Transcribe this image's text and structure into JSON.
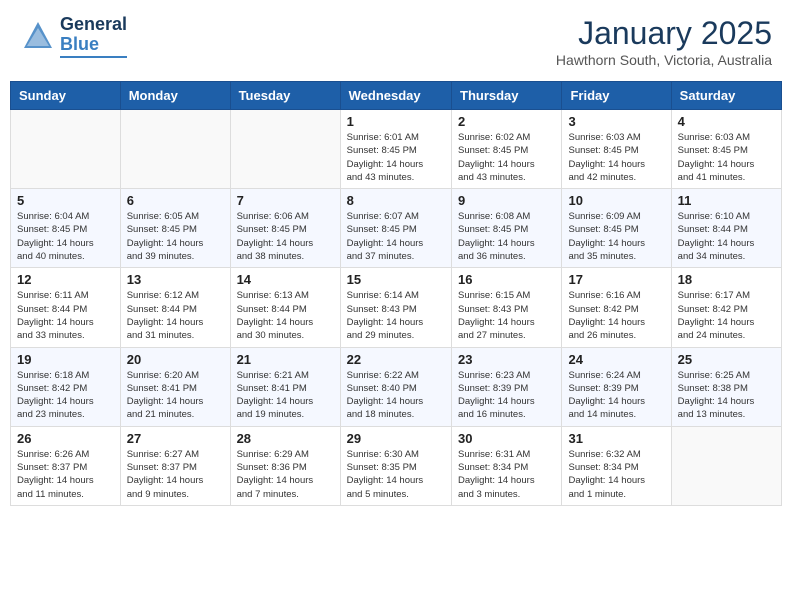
{
  "header": {
    "logo_general": "General",
    "logo_blue": "Blue",
    "month_title": "January 2025",
    "location": "Hawthorn South, Victoria, Australia"
  },
  "calendar": {
    "days_of_week": [
      "Sunday",
      "Monday",
      "Tuesday",
      "Wednesday",
      "Thursday",
      "Friday",
      "Saturday"
    ],
    "weeks": [
      [
        {
          "day": "",
          "info": ""
        },
        {
          "day": "",
          "info": ""
        },
        {
          "day": "",
          "info": ""
        },
        {
          "day": "1",
          "info": "Sunrise: 6:01 AM\nSunset: 8:45 PM\nDaylight: 14 hours\nand 43 minutes."
        },
        {
          "day": "2",
          "info": "Sunrise: 6:02 AM\nSunset: 8:45 PM\nDaylight: 14 hours\nand 43 minutes."
        },
        {
          "day": "3",
          "info": "Sunrise: 6:03 AM\nSunset: 8:45 PM\nDaylight: 14 hours\nand 42 minutes."
        },
        {
          "day": "4",
          "info": "Sunrise: 6:03 AM\nSunset: 8:45 PM\nDaylight: 14 hours\nand 41 minutes."
        }
      ],
      [
        {
          "day": "5",
          "info": "Sunrise: 6:04 AM\nSunset: 8:45 PM\nDaylight: 14 hours\nand 40 minutes."
        },
        {
          "day": "6",
          "info": "Sunrise: 6:05 AM\nSunset: 8:45 PM\nDaylight: 14 hours\nand 39 minutes."
        },
        {
          "day": "7",
          "info": "Sunrise: 6:06 AM\nSunset: 8:45 PM\nDaylight: 14 hours\nand 38 minutes."
        },
        {
          "day": "8",
          "info": "Sunrise: 6:07 AM\nSunset: 8:45 PM\nDaylight: 14 hours\nand 37 minutes."
        },
        {
          "day": "9",
          "info": "Sunrise: 6:08 AM\nSunset: 8:45 PM\nDaylight: 14 hours\nand 36 minutes."
        },
        {
          "day": "10",
          "info": "Sunrise: 6:09 AM\nSunset: 8:45 PM\nDaylight: 14 hours\nand 35 minutes."
        },
        {
          "day": "11",
          "info": "Sunrise: 6:10 AM\nSunset: 8:44 PM\nDaylight: 14 hours\nand 34 minutes."
        }
      ],
      [
        {
          "day": "12",
          "info": "Sunrise: 6:11 AM\nSunset: 8:44 PM\nDaylight: 14 hours\nand 33 minutes."
        },
        {
          "day": "13",
          "info": "Sunrise: 6:12 AM\nSunset: 8:44 PM\nDaylight: 14 hours\nand 31 minutes."
        },
        {
          "day": "14",
          "info": "Sunrise: 6:13 AM\nSunset: 8:44 PM\nDaylight: 14 hours\nand 30 minutes."
        },
        {
          "day": "15",
          "info": "Sunrise: 6:14 AM\nSunset: 8:43 PM\nDaylight: 14 hours\nand 29 minutes."
        },
        {
          "day": "16",
          "info": "Sunrise: 6:15 AM\nSunset: 8:43 PM\nDaylight: 14 hours\nand 27 minutes."
        },
        {
          "day": "17",
          "info": "Sunrise: 6:16 AM\nSunset: 8:42 PM\nDaylight: 14 hours\nand 26 minutes."
        },
        {
          "day": "18",
          "info": "Sunrise: 6:17 AM\nSunset: 8:42 PM\nDaylight: 14 hours\nand 24 minutes."
        }
      ],
      [
        {
          "day": "19",
          "info": "Sunrise: 6:18 AM\nSunset: 8:42 PM\nDaylight: 14 hours\nand 23 minutes."
        },
        {
          "day": "20",
          "info": "Sunrise: 6:20 AM\nSunset: 8:41 PM\nDaylight: 14 hours\nand 21 minutes."
        },
        {
          "day": "21",
          "info": "Sunrise: 6:21 AM\nSunset: 8:41 PM\nDaylight: 14 hours\nand 19 minutes."
        },
        {
          "day": "22",
          "info": "Sunrise: 6:22 AM\nSunset: 8:40 PM\nDaylight: 14 hours\nand 18 minutes."
        },
        {
          "day": "23",
          "info": "Sunrise: 6:23 AM\nSunset: 8:39 PM\nDaylight: 14 hours\nand 16 minutes."
        },
        {
          "day": "24",
          "info": "Sunrise: 6:24 AM\nSunset: 8:39 PM\nDaylight: 14 hours\nand 14 minutes."
        },
        {
          "day": "25",
          "info": "Sunrise: 6:25 AM\nSunset: 8:38 PM\nDaylight: 14 hours\nand 13 minutes."
        }
      ],
      [
        {
          "day": "26",
          "info": "Sunrise: 6:26 AM\nSunset: 8:37 PM\nDaylight: 14 hours\nand 11 minutes."
        },
        {
          "day": "27",
          "info": "Sunrise: 6:27 AM\nSunset: 8:37 PM\nDaylight: 14 hours\nand 9 minutes."
        },
        {
          "day": "28",
          "info": "Sunrise: 6:29 AM\nSunset: 8:36 PM\nDaylight: 14 hours\nand 7 minutes."
        },
        {
          "day": "29",
          "info": "Sunrise: 6:30 AM\nSunset: 8:35 PM\nDaylight: 14 hours\nand 5 minutes."
        },
        {
          "day": "30",
          "info": "Sunrise: 6:31 AM\nSunset: 8:34 PM\nDaylight: 14 hours\nand 3 minutes."
        },
        {
          "day": "31",
          "info": "Sunrise: 6:32 AM\nSunset: 8:34 PM\nDaylight: 14 hours\nand 1 minute."
        },
        {
          "day": "",
          "info": ""
        }
      ]
    ]
  }
}
